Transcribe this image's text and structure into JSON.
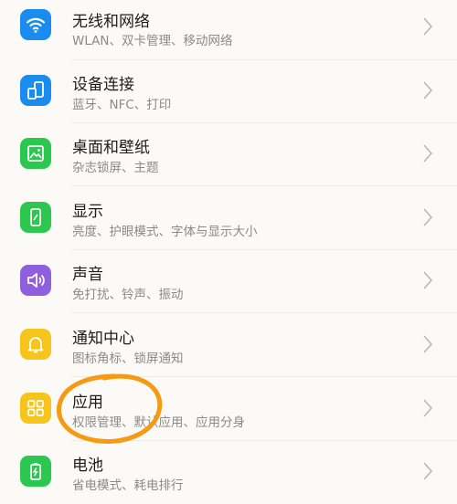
{
  "settings": {
    "items": [
      {
        "title": "无线和网络",
        "subtitle": "WLAN、双卡管理、移动网络",
        "icon": "wifi-icon",
        "color": "#1a8cf0"
      },
      {
        "title": "设备连接",
        "subtitle": "蓝牙、NFC、打印",
        "icon": "device-connection-icon",
        "color": "#1a8cf0"
      },
      {
        "title": "桌面和壁纸",
        "subtitle": "杂志锁屏、主题",
        "icon": "wallpaper-icon",
        "color": "#2cc74f"
      },
      {
        "title": "显示",
        "subtitle": "亮度、护眼模式、字体与显示大小",
        "icon": "display-icon",
        "color": "#2cc74f"
      },
      {
        "title": "声音",
        "subtitle": "免打扰、铃声、振动",
        "icon": "sound-icon",
        "color": "#8f5fe0"
      },
      {
        "title": "通知中心",
        "subtitle": "图标角标、锁屏通知",
        "icon": "bell-icon",
        "color": "#f7c41b"
      },
      {
        "title": "应用",
        "subtitle": "权限管理、默认应用、应用分身",
        "icon": "apps-grid-icon",
        "color": "#f7c41b"
      },
      {
        "title": "电池",
        "subtitle": "省电模式、耗电排行",
        "icon": "battery-icon",
        "color": "#2cc74f"
      }
    ]
  },
  "annotation": {
    "color": "#f59a12"
  }
}
